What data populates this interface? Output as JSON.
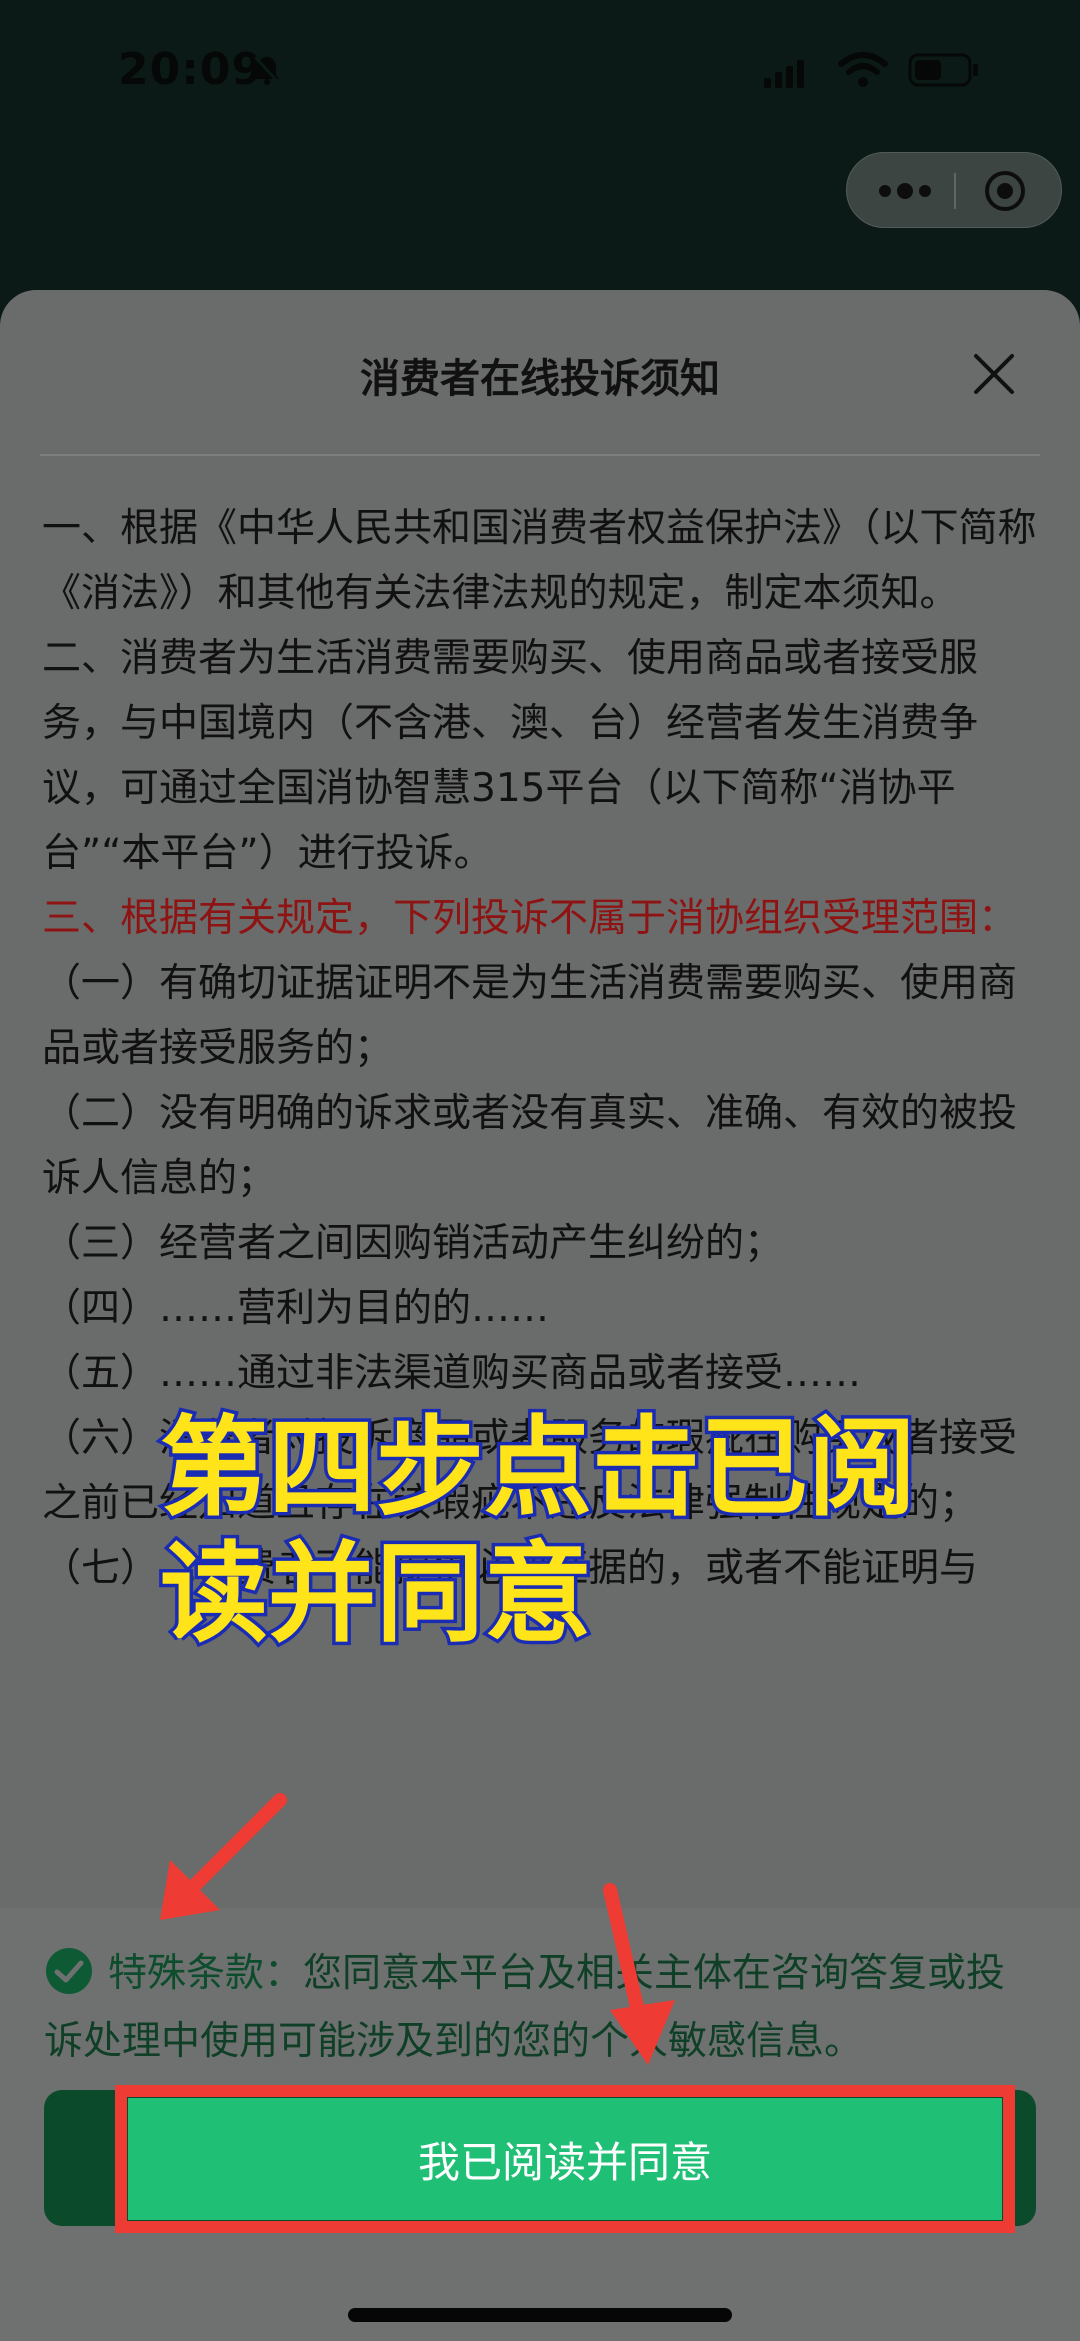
{
  "status_bar": {
    "time": "20:09"
  },
  "capsule": {
    "more_icon": "more-dots-icon",
    "close_icon": "target-circle-icon"
  },
  "dialog": {
    "title": "消费者在线投诉须知",
    "close_icon": "close-x-icon",
    "paragraphs": [
      "一、根据《中华人民共和国消费者权益保护法》（以下简称《消法》）和其他有关法律法规的规定，制定本须知。",
      "二、消费者为生活消费需要购买、使用商品或者接受服务，与中国境内（不含港、澳、台）经营者发生消费争议，可通过全国消协智慧315平台（以下简称“消协平台”“本平台”）进行投诉。",
      "三、根据有关规定，下列投诉不属于消协组织受理范围：",
      "（一）有确切证据证明不是为生活消费需要购买、使用商品或者接受服务的；",
      "（二）没有明确的诉求或者没有真实、准确、有效的被投诉人信息的；",
      "（三）经营者之间因购销活动产生纠纷的；",
      "（四）……营利为目的的……",
      "（五）……通过非法渠道购买商品或者接受……",
      "（六）消费者对投诉商品或者服务的瑕疵在购买或者接受之前已经知道且存在该瑕疵不违反法律强制性规定的；",
      "（七）……费者不能提供必要证据的，或者不能证明与"
    ]
  },
  "agreement": {
    "label": "特殊条款：",
    "text": "您同意本平台及相关主体在咨询答复或投诉处理中使用可能涉及到的您的个人敏感信息。",
    "check_icon": "check-circle-icon"
  },
  "agree_button": {
    "label": "我已阅读并同意"
  },
  "overlay_caption": {
    "line1": "第四步点击已阅",
    "line2": "读并同意"
  },
  "colors": {
    "accent_green": "#1fbf76",
    "highlight_red": "#8e1414",
    "caption_yellow": "#ffe41a",
    "caption_outline": "#1b2cb4",
    "frame_red": "#ee3b33"
  }
}
